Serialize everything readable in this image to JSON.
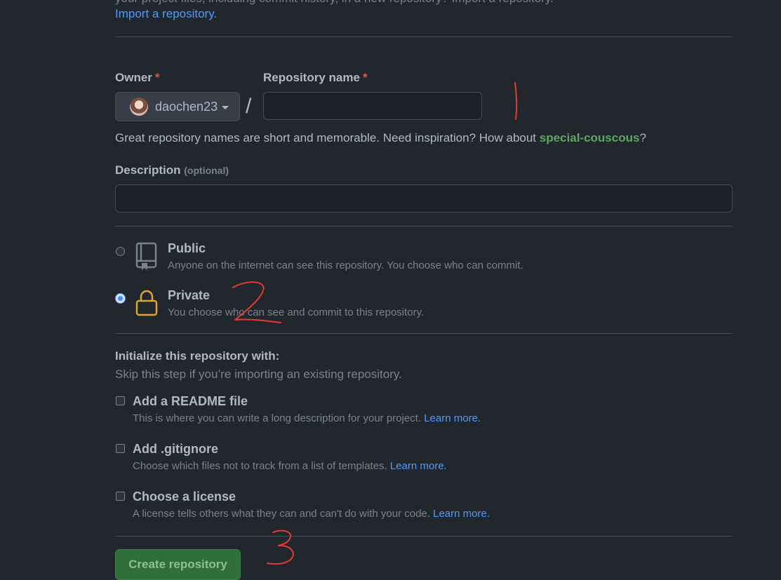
{
  "intro": {
    "top_text": "your project files, including commit history, in a new repository? Import a repository.",
    "import_link": "Import a repository."
  },
  "owner": {
    "label": "Owner",
    "required_mark": "*",
    "value": "daochen23"
  },
  "separator": "/",
  "repo_name": {
    "label": "Repository name",
    "required_mark": "*",
    "value": "",
    "placeholder": ""
  },
  "hint": {
    "prefix": "Great repository names are short and memorable. Need inspiration? How about ",
    "suggestion": "special-couscous",
    "suffix": "?"
  },
  "description": {
    "label": "Description",
    "optional": "(optional)",
    "value": ""
  },
  "visibility": {
    "options": [
      {
        "title": "Public",
        "desc": "Anyone on the internet can see this repository. You choose who can commit.",
        "selected": false,
        "icon": "repo-icon"
      },
      {
        "title": "Private",
        "desc": "You choose who can see and commit to this repository.",
        "selected": true,
        "icon": "lock-icon"
      }
    ]
  },
  "init": {
    "title": "Initialize this repository with:",
    "subtitle": "Skip this step if you’re importing an existing repository.",
    "items": [
      {
        "title": "Add a README file",
        "desc": "This is where you can write a long description for your project.",
        "link": "Learn more.",
        "checked": false
      },
      {
        "title": "Add .gitignore",
        "desc": "Choose which files not to track from a list of templates.",
        "link": "Learn more.",
        "checked": false
      },
      {
        "title": "Choose a license",
        "desc": "A license tells others what they can and can't do with your code.",
        "link": "Learn more.",
        "checked": false
      }
    ]
  },
  "create_button": "Create repository",
  "colors": {
    "background": "#22272e",
    "text": "#adbac7",
    "muted": "#768390",
    "link": "#539bf5",
    "suggestion": "#57ab5a",
    "required": "#e5534b",
    "lock": "#e0a431",
    "annotation": "#e53935",
    "create_button": "#2f6f3c"
  },
  "annotations": [
    "1",
    "2",
    "3"
  ]
}
